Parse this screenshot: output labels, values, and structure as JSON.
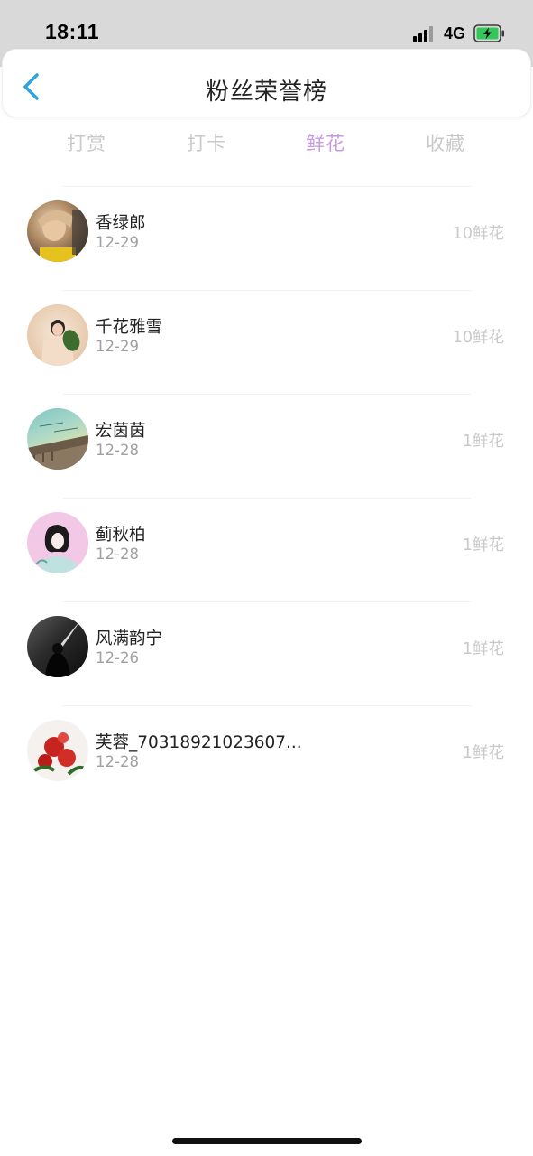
{
  "status_bar": {
    "time": "18:11",
    "network": "4G",
    "signal_icon": "cellular-signal-icon",
    "battery_icon": "battery-charging-icon"
  },
  "header": {
    "title": "粉丝荣誉榜",
    "back_icon": "chevron-left-icon"
  },
  "tabs": [
    {
      "label": "打赏",
      "active": false
    },
    {
      "label": "打卡",
      "active": false
    },
    {
      "label": "鲜花",
      "active": true
    },
    {
      "label": "收藏",
      "active": false
    }
  ],
  "fans": [
    {
      "name": "香绿郎",
      "date": "12-29",
      "count": "10鲜花"
    },
    {
      "name": "千花雅雪",
      "date": "12-29",
      "count": "10鲜花"
    },
    {
      "name": "宏茵茵",
      "date": "12-28",
      "count": "1鲜花"
    },
    {
      "name": "蓟秋柏",
      "date": "12-28",
      "count": "1鲜花"
    },
    {
      "name": "风满韵宁",
      "date": "12-26",
      "count": "1鲜花"
    },
    {
      "name": "芙蓉_70318921023607...",
      "date": "12-28",
      "count": "1鲜花"
    }
  ],
  "colors": {
    "active_tab": "#c79be0",
    "inactive_tab": "#c9c9c9",
    "back_icon": "#2fa3e0",
    "status_bar_bg": "#d9d9d9"
  }
}
